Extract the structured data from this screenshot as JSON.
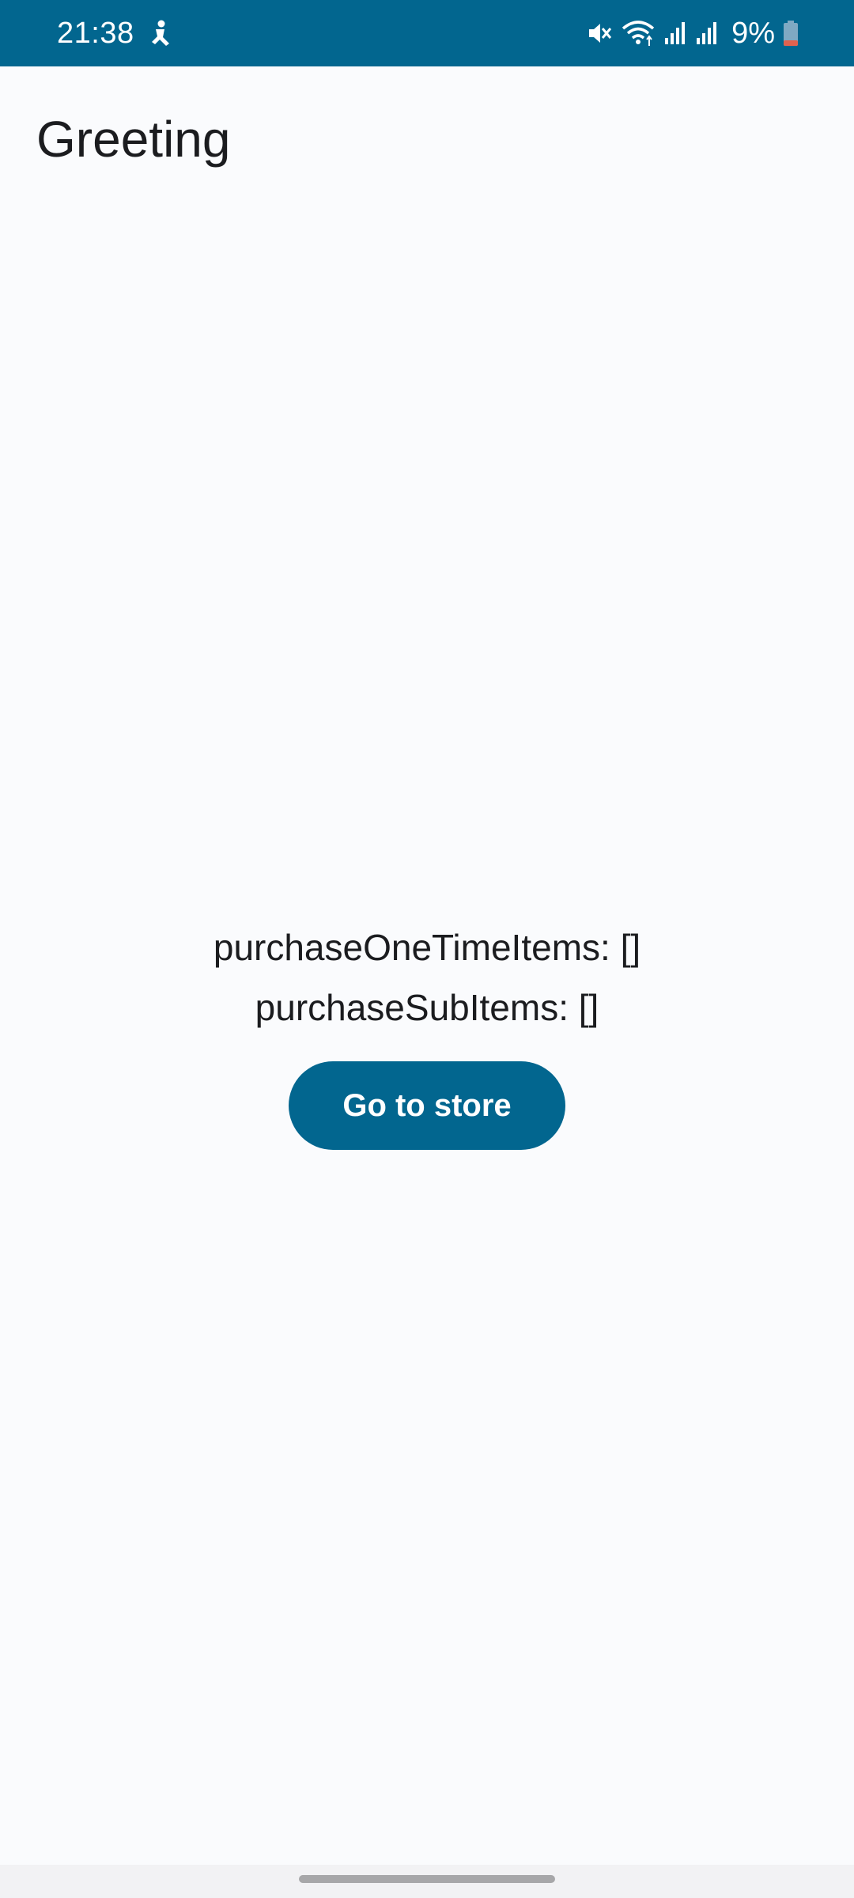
{
  "status_bar": {
    "time": "21:38",
    "battery_percent": "9%",
    "icons": [
      "accessibility-icon",
      "mute-icon",
      "wifi-icon",
      "signal-icon",
      "signal-icon",
      "battery-icon"
    ],
    "background_color": "#02668f"
  },
  "app": {
    "title": "Greeting"
  },
  "main": {
    "purchase_one_time_items": "purchaseOneTimeItems: []",
    "purchase_sub_items": "purchaseSubItems: []",
    "store_button_label": "Go to store"
  },
  "colors": {
    "accent": "#02668f",
    "background": "#fafbfd",
    "text": "#1b1c1f"
  }
}
